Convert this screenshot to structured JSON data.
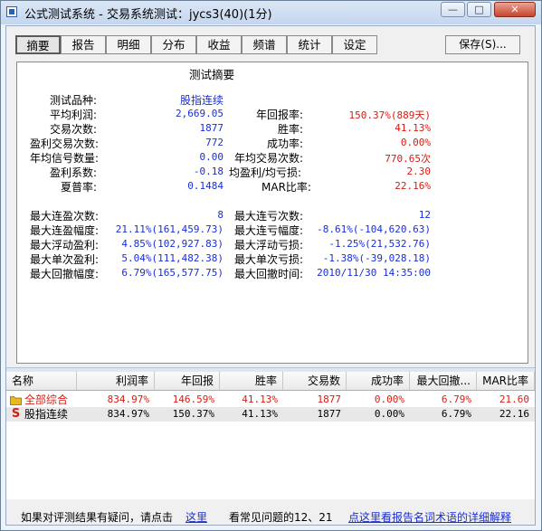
{
  "window": {
    "title": "公式测试系统 - 交易系统测试：jycs3(40)(1分)",
    "min_glyph": "—",
    "max_glyph": "□",
    "close_glyph": "✕"
  },
  "tabs": [
    "摘要",
    "报告",
    "明细",
    "分布",
    "收益",
    "频谱",
    "统计",
    "设定"
  ],
  "save_label": "保存(S)...",
  "summary": {
    "title": "测试摘要",
    "variety_label": "测试品种:",
    "variety_value": "股指连续",
    "left": [
      {
        "label": "平均利润:",
        "value": "2,669.05"
      },
      {
        "label": "交易次数:",
        "value": "1877"
      },
      {
        "label": "盈利交易次数:",
        "value": "772"
      },
      {
        "label": "年均信号数量:",
        "value": "0.00"
      },
      {
        "label": "盈利系数:",
        "value": "-0.18"
      },
      {
        "label": "夏普率:",
        "value": "0.1484"
      }
    ],
    "right": [
      {
        "label": "年回报率:",
        "value": "150.37%(889天)"
      },
      {
        "label": "胜率:",
        "value": "41.13%"
      },
      {
        "label": "成功率:",
        "value": "0.00%"
      },
      {
        "label": "年均交易次数:",
        "value": "770.65次"
      },
      {
        "label": "均盈利/均亏损:",
        "value": "2.30"
      },
      {
        "label": "MAR比率:",
        "value": "22.16%"
      }
    ],
    "left2": [
      {
        "label": "最大连盈次数:",
        "value": "8"
      },
      {
        "label": "最大连盈幅度:",
        "value": "21.11%(161,459.73)"
      },
      {
        "label": "最大浮动盈利:",
        "value": "4.85%(102,927.83)"
      },
      {
        "label": "最大单次盈利:",
        "value": "5.04%(111,482.38)"
      },
      {
        "label": "最大回撤幅度:",
        "value": "6.79%(165,577.75)"
      }
    ],
    "right2": [
      {
        "label": "最大连亏次数:",
        "value": "12"
      },
      {
        "label": "最大连亏幅度:",
        "value": "-8.61%(-104,620.63)"
      },
      {
        "label": "最大浮动亏损:",
        "value": "-1.25%(21,532.76)"
      },
      {
        "label": "最大单次亏损:",
        "value": "-1.38%(-39,028.18)"
      },
      {
        "label": "最大回撤时间:",
        "value": "2010/11/30 14:35:00"
      }
    ]
  },
  "table": {
    "headers": [
      "名称",
      "利润率",
      "年回报",
      "胜率",
      "交易数",
      "成功率",
      "最大回撤...",
      "MAR比率"
    ],
    "rows": [
      {
        "name": "全部综合",
        "profit": "834.97%",
        "annual": "146.59%",
        "win": "41.13%",
        "trades": "1877",
        "success": "0.00%",
        "drawdown": "6.79%",
        "mar": "21.60",
        "icon": "folder-icon"
      },
      {
        "name": "股指连续",
        "profit": "834.97%",
        "annual": "150.37%",
        "win": "41.13%",
        "trades": "1877",
        "success": "0.00%",
        "drawdown": "6.79%",
        "mar": "22.16",
        "icon": "s-icon",
        "icon_text": "S"
      }
    ]
  },
  "footer": {
    "question_text": "如果对评测结果有疑问，请点击",
    "here_link": "这里",
    "faq_text": "看常见问题的12、21",
    "glossary_link": "点这里看报告名词术语的详细解释"
  },
  "colors": {
    "blue": "#1a2ed3",
    "red": "#d61c14",
    "folder": "#e8b923"
  }
}
